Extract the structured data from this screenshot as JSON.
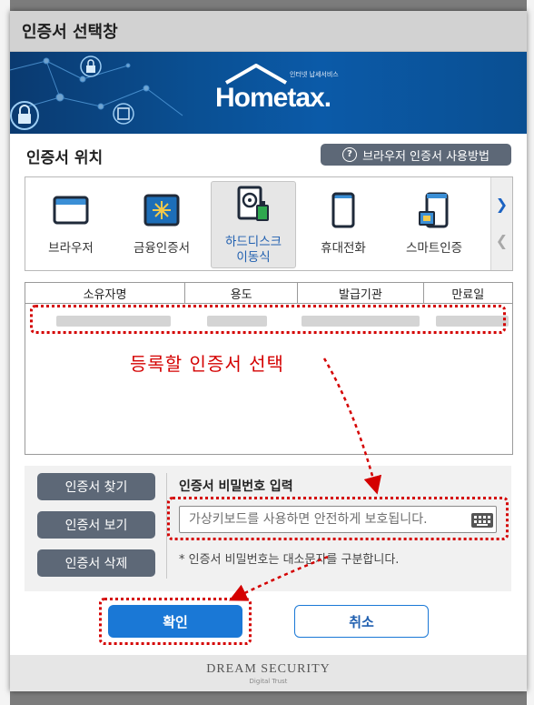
{
  "dialog": {
    "title": "인증서 선택창"
  },
  "banner": {
    "logo_small": "인터넷 납세서비스",
    "logo_main": "Hometax."
  },
  "location": {
    "title": "인증서 위치",
    "help_label": "브라우저 인증서 사용방법",
    "items": [
      {
        "label": "브라우저",
        "icon": "browser-icon"
      },
      {
        "label": "금융인증서",
        "icon": "financial-cert-icon"
      },
      {
        "label": "하드디스크\n이동식",
        "icon": "harddisk-usb-icon"
      },
      {
        "label": "휴대전화",
        "icon": "mobile-phone-icon"
      },
      {
        "label": "스마트인증",
        "icon": "smart-cert-icon"
      }
    ],
    "selected": "하드디스크 이동식"
  },
  "table": {
    "columns": [
      "소유자명",
      "용도",
      "발급기관",
      "만료일"
    ]
  },
  "annotation": "등록할 인증서 선택",
  "actions": {
    "find": "인증서 찾기",
    "view": "인증서 보기",
    "delete": "인증서 삭제"
  },
  "password": {
    "label": "인증서 비밀번호 입력",
    "placeholder": "가상키보드를 사용하면 안전하게 보호됩니다.",
    "note": "* 인증서 비밀번호는 대소문자를 구분합니다."
  },
  "buttons": {
    "ok": "확인",
    "cancel": "취소"
  },
  "footer": {
    "brand": "DREAM SECURITY",
    "tagline": "Digital Trust"
  },
  "colors": {
    "accent": "#1a78d6",
    "annotation": "#d40000",
    "dark_button": "#5d6877"
  }
}
